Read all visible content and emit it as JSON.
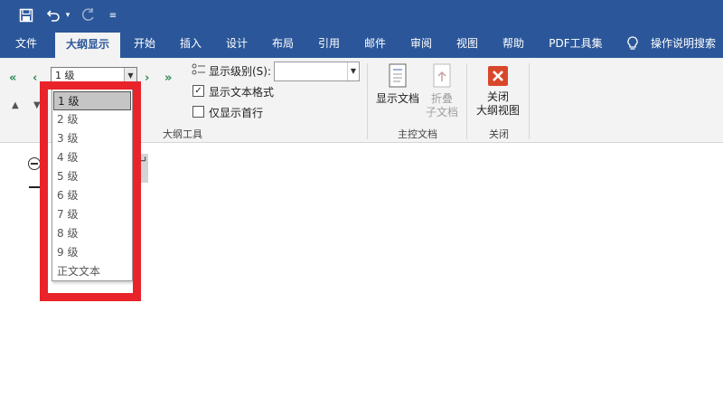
{
  "tabs": [
    {
      "id": "file",
      "label": "文件"
    },
    {
      "id": "outline",
      "label": "大纲显示"
    },
    {
      "id": "home",
      "label": "开始"
    },
    {
      "id": "insert",
      "label": "插入"
    },
    {
      "id": "design",
      "label": "设计"
    },
    {
      "id": "layout",
      "label": "布局"
    },
    {
      "id": "references",
      "label": "引用"
    },
    {
      "id": "mailings",
      "label": "邮件"
    },
    {
      "id": "review",
      "label": "审阅"
    },
    {
      "id": "view",
      "label": "视图"
    },
    {
      "id": "help",
      "label": "帮助"
    },
    {
      "id": "pdf",
      "label": "PDF工具集"
    }
  ],
  "tellme": {
    "label": "操作说明搜索"
  },
  "outline_tools": {
    "level_value": "1 级",
    "show_level_label": "显示级别(S):",
    "show_text_format_label": "显示文本格式",
    "show_text_format_checked": true,
    "first_line_only_label": "仅显示首行",
    "first_line_only_checked": false,
    "group_label": "大纲工具"
  },
  "master": {
    "show_doc": "显示文档",
    "collapse_line1": "折叠",
    "collapse_line2": "子文档",
    "group_label": "主控文档"
  },
  "close": {
    "line1": "关闭",
    "line2": "大纲视图",
    "group_label": "关闭"
  },
  "level_dropdown": {
    "options": [
      "1 级",
      "2 级",
      "3 级",
      "4 级",
      "5 级",
      "6 级",
      "7 级",
      "8 级",
      "9 级",
      "正文文本"
    ],
    "selected": "1 级"
  },
  "colors": {
    "brand": "#2b579a",
    "highlight": "#e8232a",
    "close_icon": "#d9472b",
    "arrow": "#2e8b57"
  }
}
